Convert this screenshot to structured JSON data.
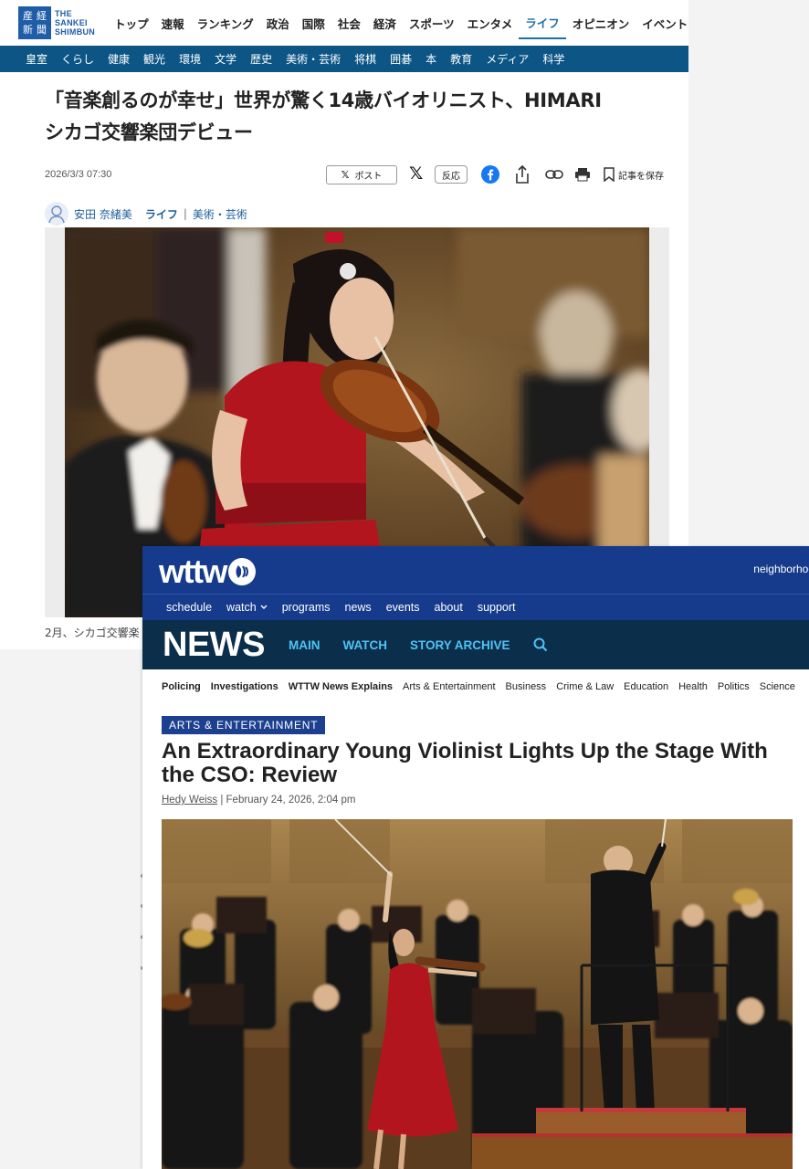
{
  "sankei": {
    "logo_kanji": [
      "産",
      "経",
      "新",
      "聞"
    ],
    "logo_text": [
      "THE",
      "SANKEI",
      "SHIMBUN"
    ],
    "nav": [
      "トップ",
      "速報",
      "ランキング",
      "政治",
      "国際",
      "社会",
      "経済",
      "スポーツ",
      "エンタメ",
      "ライフ",
      "オピニオン",
      "イベント"
    ],
    "nav_active": "ライフ",
    "subnav": [
      "皇室",
      "くらし",
      "健康",
      "観光",
      "環境",
      "文学",
      "歴史",
      "美術・芸術",
      "将棋",
      "囲碁",
      "本",
      "教育",
      "メディア",
      "科学"
    ],
    "title_line1": "「音楽創るのが幸せ」世界が驚く14歳バイオリニスト、HIMARI",
    "title_line2": "シカゴ交響楽団デビュー",
    "date": "2026/3/3 07:30",
    "post_label": "ポスト",
    "reaction_label": "反応",
    "save_label": "記事を保存",
    "author": "安田 奈緒美",
    "category": "ライフ",
    "separator": "|",
    "subcategory": "美術・芸術",
    "caption": "2月、シカゴ交響楽"
  },
  "wttw": {
    "logo_text": "wttw",
    "neighborhoods": "neighborhoo",
    "nav": [
      "schedule",
      "watch",
      "programs",
      "news",
      "events",
      "about",
      "support"
    ],
    "news_logo": "NEWS",
    "news_links": [
      "MAIN",
      "WATCH",
      "STORY ARCHIVE"
    ],
    "categories_bold": [
      "Policing",
      "Investigations",
      "WTTW News Explains"
    ],
    "categories": [
      "Arts & Entertainment",
      "Business",
      "Crime & Law",
      "Education",
      "Health",
      "Politics",
      "Science"
    ],
    "badge": "ARTS & ENTERTAINMENT",
    "headline": "An Extraordinary Young Violinist Lights Up the Stage With the CSO: Review",
    "author": "Hedy Weiss",
    "date": " | February 24, 2026, 2:04 pm"
  },
  "colors": {
    "sankei_blue": "#0c5585",
    "sankei_logo": "#1f5da8",
    "sankei_active": "#1d6fa8",
    "wttw_blue": "#163b8c",
    "wttw_news_bar": "#0b2e4a",
    "wttw_news_link": "#4fc3f7",
    "wttw_badge": "#1d3f8f",
    "dress_red": "#b3151f"
  },
  "icons": [
    "x-logo-icon",
    "facebook-icon",
    "share-icon",
    "link-icon",
    "print-icon",
    "bookmark-icon",
    "user-icon",
    "search-icon",
    "chevron-down-icon",
    "pbs-head-icon"
  ]
}
